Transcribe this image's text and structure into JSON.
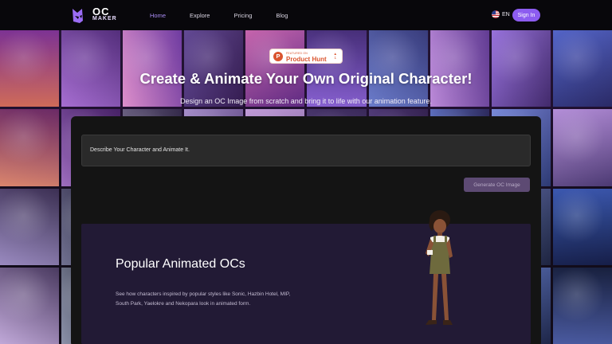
{
  "nav": {
    "logo_oc": "OC",
    "logo_maker": "MAKER",
    "links": [
      "Home",
      "Explore",
      "Pricing",
      "Blog"
    ],
    "active_link": "Home",
    "lang": "EN",
    "signin_label": "Sign In"
  },
  "hero": {
    "badge_small": "FEATURED ON",
    "badge_big": "Product Hunt",
    "title": "Create & Animate Your Own Original Character!",
    "subtitle": "Design an OC Image from scratch and bring it to life with our animation feature."
  },
  "prompt": {
    "text": "Describe Your Character and Animate It."
  },
  "generate_label": "Generate OC Image",
  "popular": {
    "title": "Popular Animated OCs",
    "description": "See how characters inspired by popular styles like Sonic, Hazbin Hotel, MIP, South Park, Yaelokre and Nekopara look in animated form."
  },
  "colors": {
    "accent": "#8c5cf0",
    "active_nav": "#a98cf3",
    "card_bg": "#221a35",
    "producthunt": "#da552f"
  }
}
